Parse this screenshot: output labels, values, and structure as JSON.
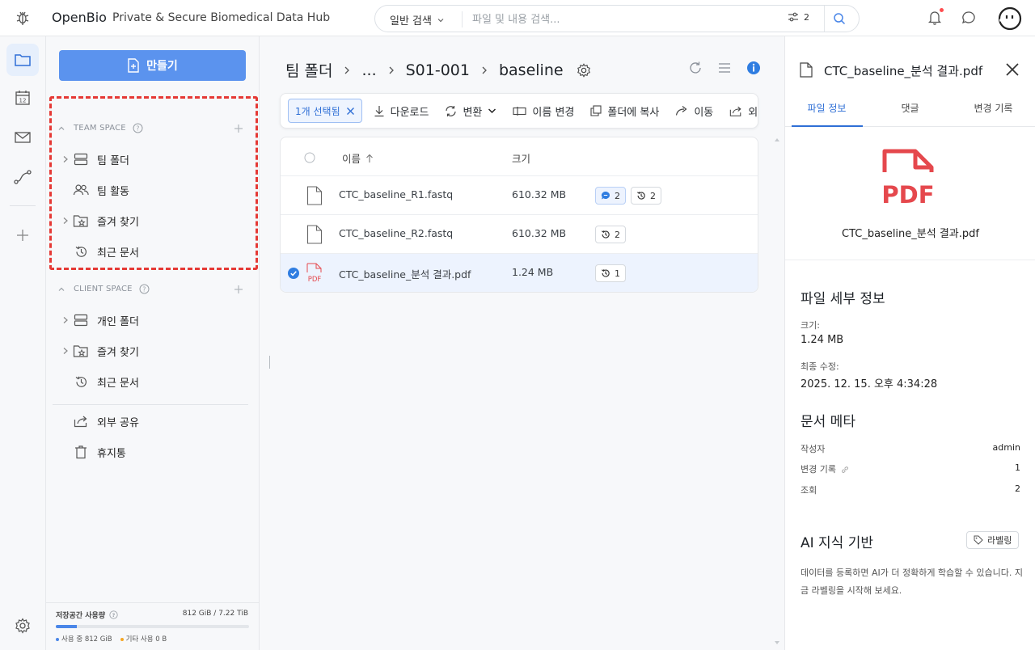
{
  "app": {
    "brand": "OpenBio",
    "tagline": "Private & Secure Biomedical Data Hub"
  },
  "search": {
    "mode": "일반 검색",
    "placeholder": "파일 및 내용 검색...",
    "filter_count": "2"
  },
  "sidebar": {
    "create_label": "만들기",
    "team_space": {
      "title": "TEAM SPACE",
      "items": [
        {
          "label": "팀 폴더",
          "icon": "server-icon"
        },
        {
          "label": "팀 활동",
          "icon": "users-icon"
        },
        {
          "label": "즐겨 찾기",
          "icon": "star-folder-icon"
        },
        {
          "label": "최근 문서",
          "icon": "history-icon"
        }
      ]
    },
    "client_space": {
      "title": "CLIENT SPACE",
      "items": [
        {
          "label": "개인 폴더",
          "icon": "server-icon"
        },
        {
          "label": "즐겨 찾기",
          "icon": "star-folder-icon"
        },
        {
          "label": "최근 문서",
          "icon": "history-icon"
        }
      ]
    },
    "extra": [
      {
        "label": "외부 공유",
        "icon": "share-icon"
      },
      {
        "label": "휴지통",
        "icon": "trash-icon"
      }
    ],
    "storage": {
      "label": "저장공간 사용량",
      "value": "812 GiB / 7.22 TiB",
      "used_fraction": 0.11,
      "legend_used": "사용 중 812 GiB",
      "legend_other": "기타 사용 0 B",
      "used_color": "#4a86e8",
      "other_color": "#f5a623"
    }
  },
  "breadcrumb": {
    "items": [
      "팀 폴더",
      "...",
      "S01-001",
      "baseline"
    ]
  },
  "toolbar": {
    "selected": "1개 선택됨",
    "download": "다운로드",
    "convert": "변환",
    "rename": "이름 변경",
    "copy": "폴더에 복사",
    "move": "이동",
    "share": "외부 공유"
  },
  "table": {
    "col_name": "이름",
    "col_size": "크기",
    "rows": [
      {
        "name": "CTC_baseline_R1.fastq",
        "size": "610.32 MB",
        "comments": "2",
        "versions": "2",
        "selected": false,
        "type": "file"
      },
      {
        "name": "CTC_baseline_R2.fastq",
        "size": "610.32 MB",
        "comments": null,
        "versions": "2",
        "selected": false,
        "type": "file"
      },
      {
        "name": "CTC_baseline_분석 결과.pdf",
        "size": "1.24 MB",
        "comments": null,
        "versions": "1",
        "selected": true,
        "type": "pdf"
      }
    ]
  },
  "panel": {
    "title": "CTC_baseline_분석 결과.pdf",
    "tabs": [
      "파일 정보",
      "댓글",
      "변경 기록"
    ],
    "active_tab": 0,
    "preview_name": "CTC_baseline_분석 결과.pdf",
    "details_heading": "파일 세부 정보",
    "size_label": "크기:",
    "size_value": "1.24 MB",
    "modified_label": "최종 수정:",
    "modified_value": "2025. 12. 15. 오후 4:34:28",
    "meta_heading": "문서 메타",
    "meta": [
      {
        "label": "작성자",
        "value": "admin"
      },
      {
        "label": "변경 기록",
        "value": "1"
      },
      {
        "label": "조회",
        "value": "2"
      }
    ],
    "ai_heading": "AI 지식 기반",
    "label_button": "라벨링",
    "ai_desc": "데이터를 등록하면 AI가 더 정확하게 학습할 수 있습니다. 지금 라벨링을 시작해 보세요.",
    "pdf_color": "#e5484d",
    "accent": "#2f6fd6"
  }
}
